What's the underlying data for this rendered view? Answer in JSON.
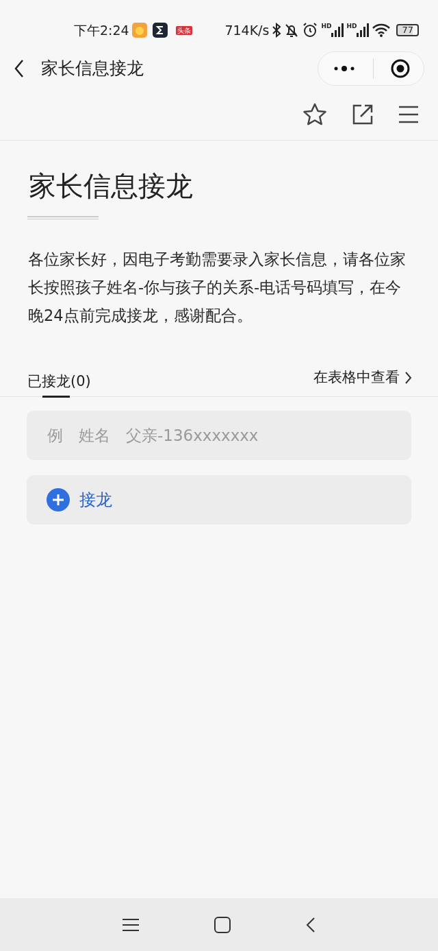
{
  "status_bar": {
    "time": "下午2:24",
    "app_badge": "头条",
    "net_speed": "714K/s",
    "signal_labels": [
      "HD",
      "HD"
    ],
    "battery": "77"
  },
  "nav": {
    "title": "家长信息接龙"
  },
  "article": {
    "title": "家长信息接龙",
    "body": "各位家长好，因电子考勤需要录入家长信息，请各位家长按照孩子姓名-你与孩子的关系-电话号码填写，在今晚24点前完成接龙，感谢配合。"
  },
  "tabs": [
    {
      "label": "已接龙(0)",
      "selected": true
    }
  ],
  "table_link": "在表格中查看",
  "entry_field": {
    "placeholder": "例　姓名　父亲-136xxxxxxx"
  },
  "join_button": "接龙"
}
